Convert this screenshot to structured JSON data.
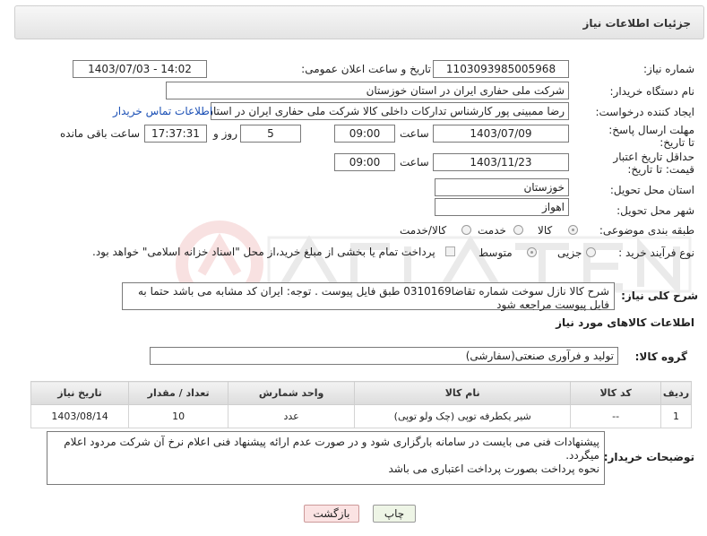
{
  "header": {
    "title": "جزئیات اطلاعات نیاز"
  },
  "fields": {
    "need_number_label": "شماره نیاز:",
    "need_number": "1103093985005968",
    "announce_label": "تاریخ و ساعت اعلان عمومی:",
    "announce_value": "1403/07/03 - 14:02",
    "buyer_org_label": "نام دستگاه خریدار:",
    "buyer_org": "شرکت ملی حفاری ایران در استان خوزستان",
    "creator_label": "ایجاد کننده درخواست:",
    "creator": "رضا ممبینی پور کارشناس تدارکات داخلی کالا شرکت ملی حفاری ایران در استان",
    "contact_link": "اطلاعات تماس خریدار",
    "deadline_label": "مهلت ارسال پاسخ: تا تاریخ:",
    "deadline_date": "1403/07/09",
    "time_label": "ساعت",
    "deadline_time": "09:00",
    "days_value": "5",
    "days_label": "روز و",
    "remaining_time": "17:37:31",
    "remaining_label": "ساعت باقی مانده",
    "validity_label": "حداقل تاریخ اعتبار قیمت: تا تاریخ:",
    "validity_date": "1403/11/23",
    "validity_time": "09:00",
    "province_label": "استان محل تحویل:",
    "province": "خوزستان",
    "city_label": "شهر محل تحویل:",
    "city": "اهواز",
    "category_label": "طبقه بندی موضوعی:",
    "category_options": [
      "کالا",
      "خدمت",
      "کالا/خدمت"
    ],
    "process_label": "نوع فرآیند خرید :",
    "process_options": [
      "جزیی",
      "متوسط"
    ],
    "payment_note": "پرداخت تمام یا بخشی از مبلغ خرید،از محل \"اسناد خزانه اسلامی\" خواهد بود.",
    "description_label": "شرح کلی نیاز:",
    "description": "شرح کالا نازل سوخت شماره تقاضا0310169 طبق فایل پیوست . توجه: ایران کد مشابه می باشد حتما به فایل پیوست مراجعه شود"
  },
  "goods": {
    "section_title": "اطلاعات کالاهای مورد نیاز",
    "group_label": "گروه کالا:",
    "group_value": "تولید و فرآوری صنعتی(سفارشی)",
    "columns": [
      "ردیف",
      "کد کالا",
      "نام کالا",
      "واحد شمارش",
      "تعداد / مقدار",
      "تاریخ نیاز"
    ],
    "rows": [
      {
        "row": "1",
        "code": "--",
        "name": "شیر یکطرفه توپی (چک ولو توپی)",
        "unit": "عدد",
        "qty": "10",
        "date": "1403/08/14"
      }
    ]
  },
  "buyer_notes": {
    "label": "توضیحات خریدار:",
    "line1": "پیشنهادات فنی می بایست در سامانه بارگزاری شود و در صورت عدم ارائه پیشنهاد فنی اعلام نرخ آن شرکت مردود اعلام",
    "line2": "میگردد.",
    "line3": "نحوه پرداخت بصورت پرداخت اعتباری می باشد"
  },
  "buttons": {
    "print": "چاپ",
    "back": "بازگشت"
  },
  "colors": {
    "link": "#1a4fb5",
    "back_button_bg": "#fbe3e3",
    "print_button_bg": "#eef5e6"
  }
}
